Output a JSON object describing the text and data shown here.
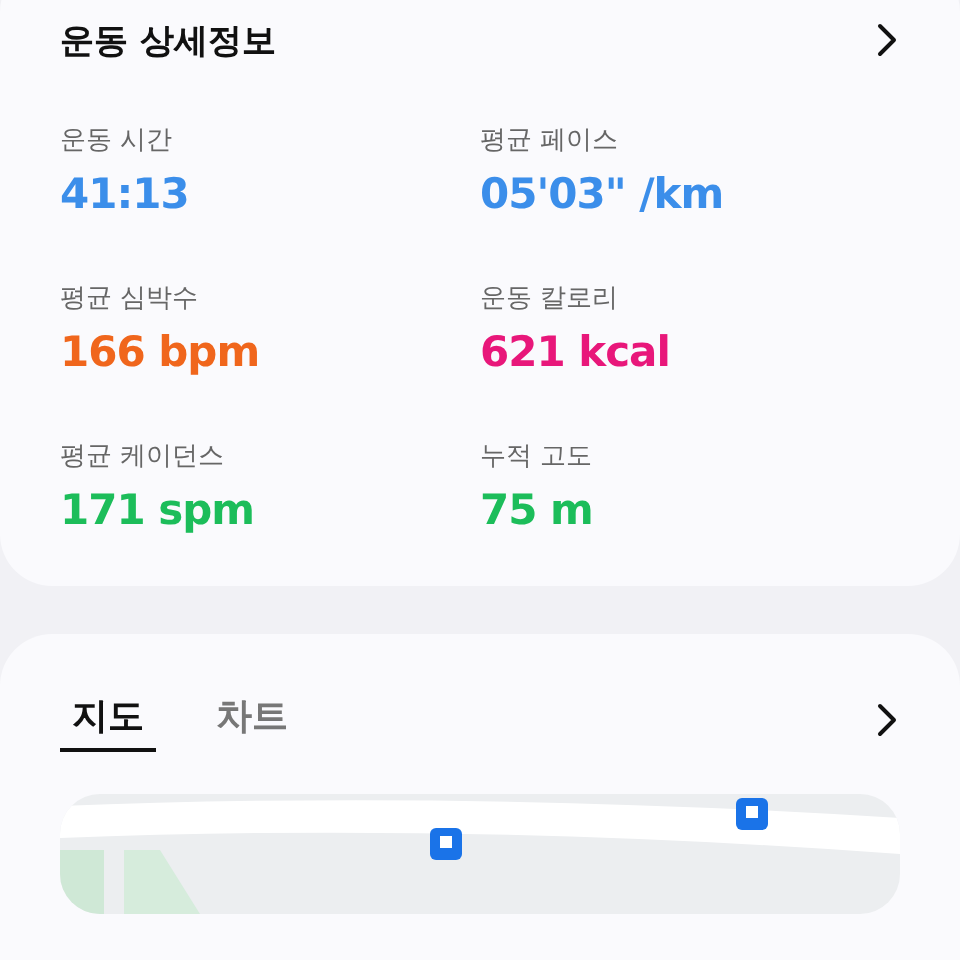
{
  "details": {
    "title": "운동 상세정보",
    "stats": [
      {
        "label": "운동 시간",
        "value": "41:13",
        "color": "#3b8eea"
      },
      {
        "label": "평균 페이스",
        "value": "05'03\" /km",
        "color": "#3b8eea"
      },
      {
        "label": "평균 심박수",
        "value": "166 bpm",
        "color": "#f0661c"
      },
      {
        "label": "운동 칼로리",
        "value": "621 kcal",
        "color": "#e8177a"
      },
      {
        "label": "평균 케이던스",
        "value": "171 spm",
        "color": "#1cbd5a"
      },
      {
        "label": "누적 고도",
        "value": "75 m",
        "color": "#1cbd5a"
      }
    ]
  },
  "map_card": {
    "tabs": [
      {
        "label": "지도",
        "selected": true
      },
      {
        "label": "차트",
        "selected": false
      }
    ]
  }
}
